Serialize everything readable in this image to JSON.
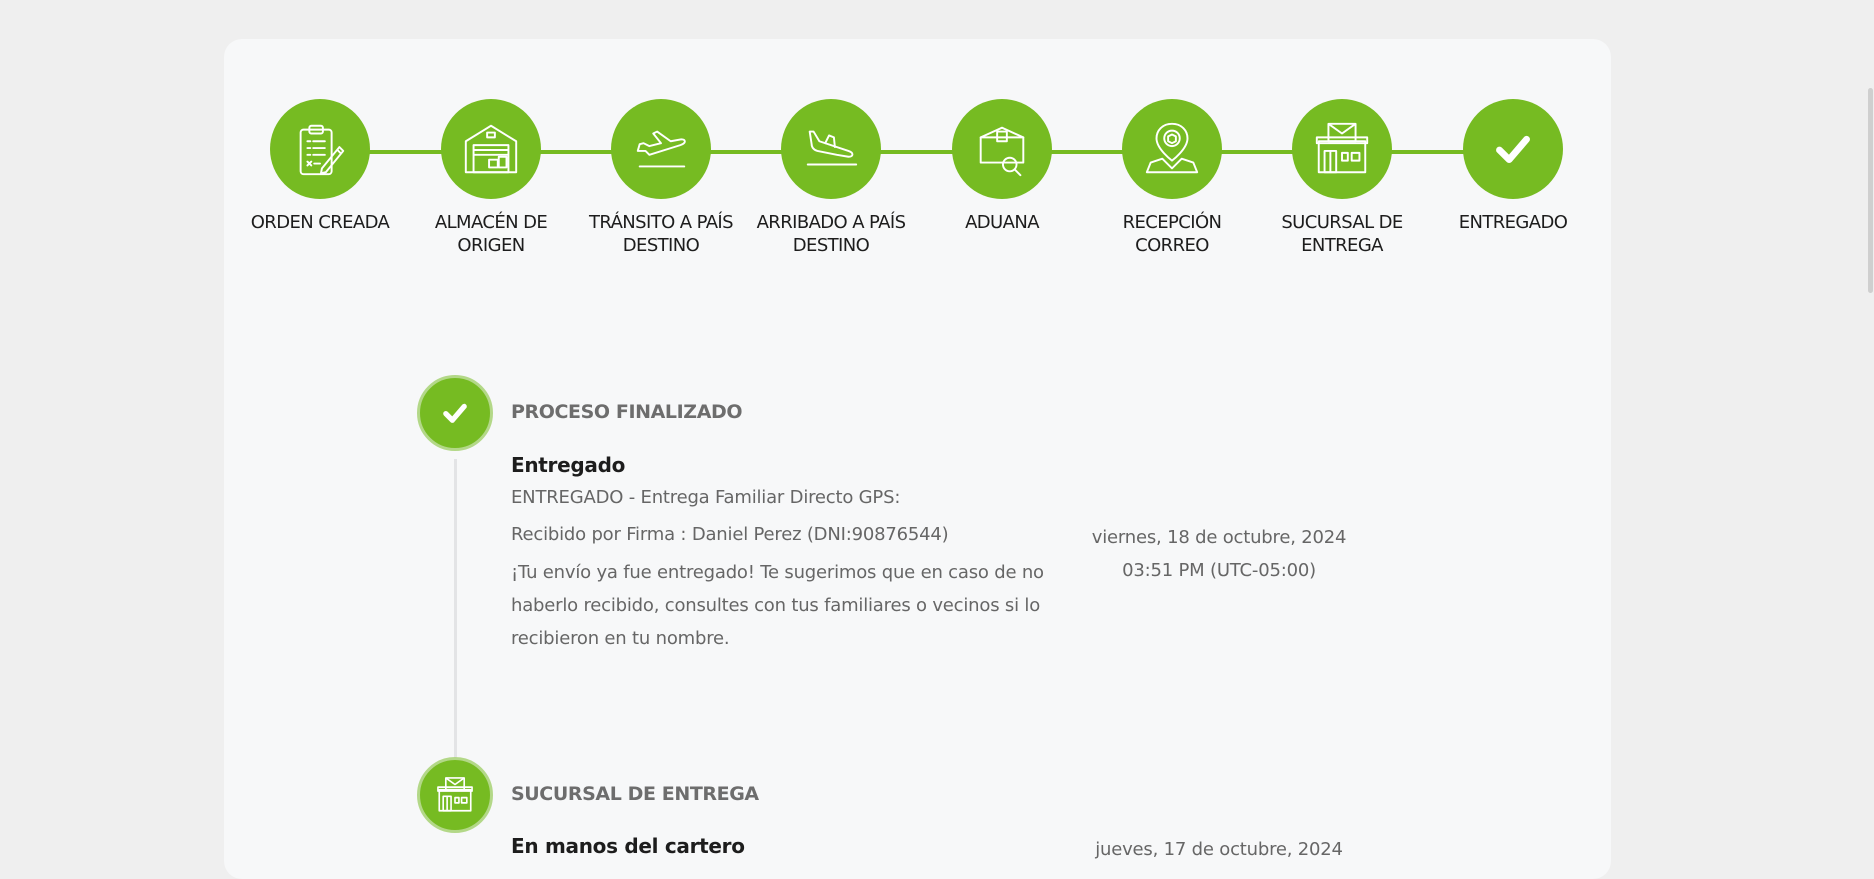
{
  "stepper": {
    "steps": [
      {
        "label": "ORDEN CREADA",
        "icon": "clipboard-checklist-icon"
      },
      {
        "label": "ALMACÉN DE ORIGEN",
        "icon": "warehouse-icon"
      },
      {
        "label": "TRÁNSITO A PAÍS DESTINO",
        "icon": "airplane-takeoff-icon"
      },
      {
        "label": "ARRIBADO A PAÍS DESTINO",
        "icon": "airplane-landing-icon"
      },
      {
        "label": "ADUANA",
        "icon": "customs-package-search-icon"
      },
      {
        "label": "RECEPCIÓN CORREO",
        "icon": "location-pin-package-icon"
      },
      {
        "label": "SUCURSAL DE ENTREGA",
        "icon": "post-office-icon"
      },
      {
        "label": "ENTREGADO",
        "icon": "checkmark-icon"
      }
    ]
  },
  "timeline": {
    "events": [
      {
        "title": "PROCESO FINALIZADO",
        "icon": "checkmark-icon",
        "heading": "Entregado",
        "line1": "ENTREGADO - Entrega Familiar Directo GPS:",
        "line2": "Recibido por Firma : Daniel Perez (DNI:90876544)",
        "message": "¡Tu envío ya fue entregado! Te sugerimos que en caso de no haberlo recibido, consultes con tus familiares o vecinos si lo recibieron en tu nombre.",
        "date": "viernes, 18 de octubre, 2024",
        "time": "03:51 PM (UTC-05:00)"
      },
      {
        "title": "SUCURSAL DE ENTREGA",
        "icon": "post-office-icon",
        "heading": "En manos del cartero",
        "date": "jueves, 17 de octubre, 2024"
      }
    ]
  },
  "colors": {
    "accent": "#76bb22",
    "page_bg": "#efefef",
    "card_bg": "#f7f8f9"
  }
}
